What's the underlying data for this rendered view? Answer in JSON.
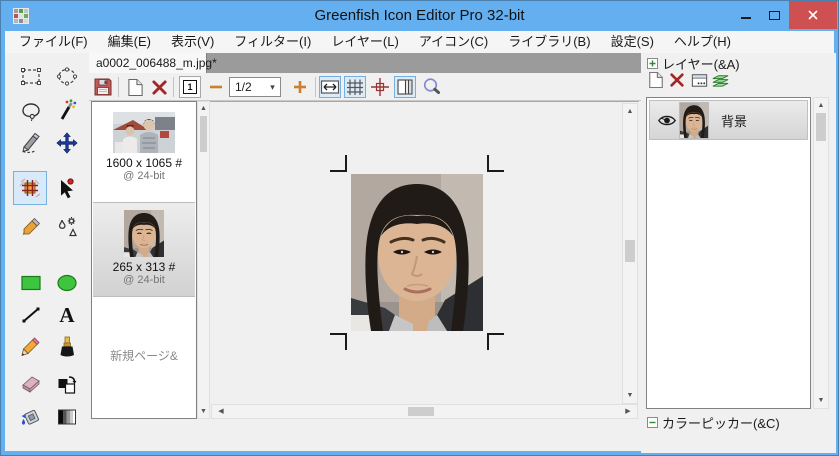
{
  "window": {
    "title": "Greenfish Icon Editor Pro 32-bit"
  },
  "menu": {
    "items": [
      "ファイル(F)",
      "編集(E)",
      "表示(V)",
      "フィルター(I)",
      "レイヤー(L)",
      "アイコン(C)",
      "ライブラリ(B)",
      "設定(S)",
      "ヘルプ(H)"
    ]
  },
  "document_tabs": {
    "active_label": "a0002_006488_m.jpg*"
  },
  "toolbar": {
    "frame_button_label": "1",
    "zoom_value": "1/2",
    "buttons": [
      "save",
      "new-page",
      "delete-page",
      "frame-number",
      "zoom-out",
      "zoom-level-select",
      "zoom-in",
      "fit-window",
      "show-grid",
      "show-centerlines",
      "show-pages",
      "test-magnifier"
    ]
  },
  "toolbox": {
    "text_glyph": "A",
    "tools": [
      "rectangle-select",
      "ellipse-select",
      "lasso-select",
      "magic-wand",
      "freehand-select",
      "move",
      "crop",
      "hotspot-picker",
      "eyedropper",
      "retouch",
      "filled-rectangle",
      "filled-ellipse",
      "line",
      "text",
      "pencil",
      "brush",
      "eraser",
      "swap-colors",
      "fill",
      "gradient"
    ]
  },
  "pages_panel": {
    "items": [
      {
        "dimensions": "1600 x 1065 #",
        "depth": "@ 24-bit",
        "selected": false
      },
      {
        "dimensions": "265 x 313 #",
        "depth": "@ 24-bit",
        "selected": true
      }
    ],
    "new_page_label": "新規ページ&"
  },
  "layers_panel": {
    "header": "レイヤー(&A)",
    "buttons": [
      "new-layer",
      "delete-layer",
      "layer-properties",
      "flatten-layers"
    ],
    "layers": [
      {
        "name": "背景",
        "visible": true
      }
    ]
  },
  "color_picker": {
    "header": "カラーピッカー(&C)"
  },
  "colors": {
    "titlebar": "#64AFF0",
    "close_button": "#CF5050",
    "tool_selection_bg": "#D8EAFA",
    "tool_selection_border": "#7AB0DD",
    "zoom_plus_minus": "#CD7E2E",
    "delete_red": "#A22626",
    "tab_strip": "#9B9B9B",
    "panel_bg": "#F0F0F0"
  }
}
